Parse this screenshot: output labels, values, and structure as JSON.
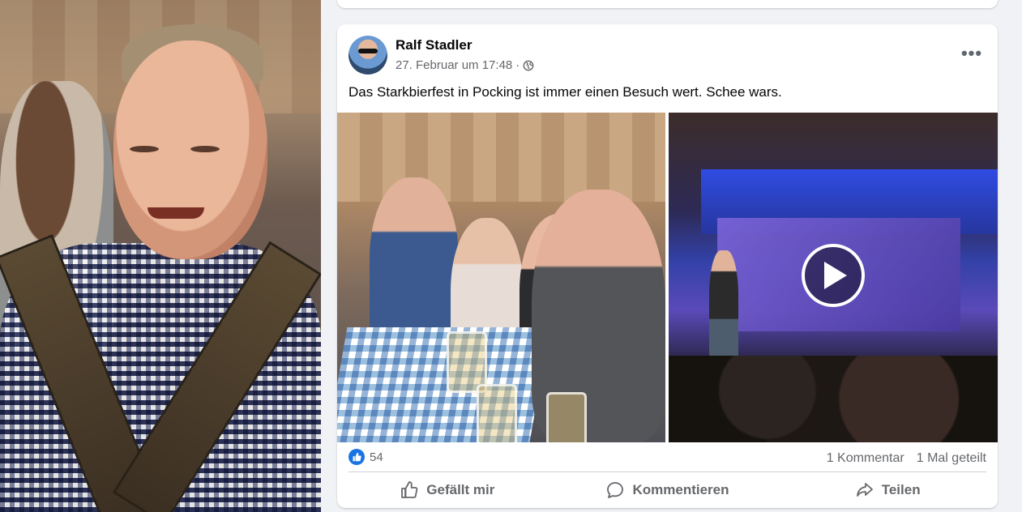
{
  "post": {
    "author": "Ralf Stadler",
    "timestamp": "27. Februar um 17:48",
    "separator": "·",
    "privacy_icon": "globe-icon",
    "more_label": "•••",
    "text": "Das Starkbierfest in Pocking ist immer einen Besuch wert. Schee wars.",
    "media": [
      {
        "type": "photo",
        "icon": "photo"
      },
      {
        "type": "video",
        "icon": "play-icon"
      }
    ],
    "reactions": {
      "icon": "like-icon",
      "count": "54"
    },
    "comments": "1 Kommentar",
    "shares": "1 Mal geteilt",
    "actions": {
      "like": "Gefällt mir",
      "comment": "Kommentieren",
      "share": "Teilen"
    }
  },
  "colors": {
    "background": "#f0f2f5",
    "card": "#ffffff",
    "secondary_text": "#65676b",
    "like_blue": "#1b74e4"
  }
}
